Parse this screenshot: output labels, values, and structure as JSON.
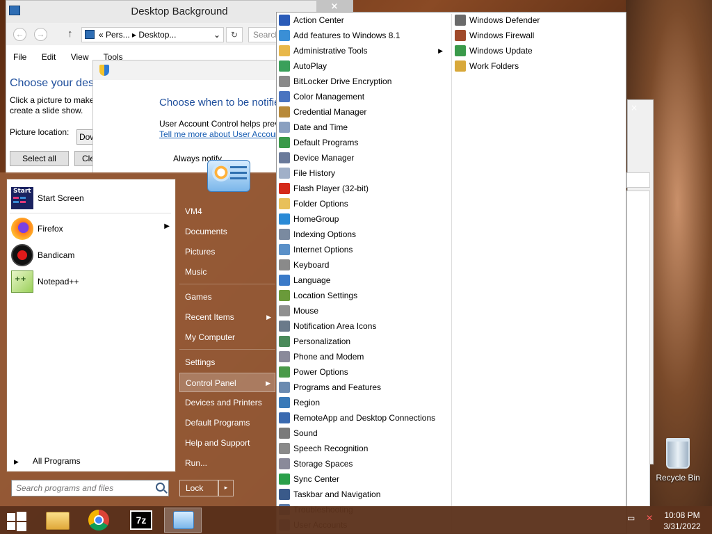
{
  "explorer": {
    "title": "Desktop Background",
    "back": "←",
    "forward": "→",
    "up": "↑",
    "address": "«  Pers...  ▸  Desktop...",
    "address_dropdown": "⌄",
    "refresh": "↻",
    "search_placeholder": "Search",
    "menu": [
      "File",
      "Edit",
      "View",
      "Tools"
    ],
    "heading": "Choose your desktop background",
    "desc1": "Click a picture to make",
    "desc2": "create a slide show.",
    "picture_location_label": "Picture location:",
    "picture_location_value": "Dow",
    "select_all": "Select all",
    "clear_all": "Cle"
  },
  "uac": {
    "heading": "Choose when to be notified",
    "text": "User Account Control helps prevent",
    "link": "Tell me more about User Account",
    "slider_label": "Always notify"
  },
  "start_menu": {
    "pinned": [
      {
        "label": "Start Screen",
        "has_arrow": false
      },
      {
        "label": "Firefox",
        "has_arrow": true
      },
      {
        "label": "Bandicam",
        "has_arrow": false
      },
      {
        "label": "Notepad++",
        "has_arrow": false
      }
    ],
    "start_tile_text": "Start",
    "all_programs": "All Programs",
    "search_placeholder": "Search programs and files",
    "right": [
      {
        "label": "VM4"
      },
      {
        "label": "Documents"
      },
      {
        "label": "Pictures"
      },
      {
        "label": "Music"
      },
      {
        "label": "Games"
      },
      {
        "label": "Recent Items",
        "arrow": true
      },
      {
        "label": "My Computer"
      },
      {
        "label": "Settings"
      },
      {
        "label": "Control Panel",
        "arrow": true,
        "highlighted": true
      },
      {
        "label": "Devices and Printers"
      },
      {
        "label": "Default Programs"
      },
      {
        "label": "Help and Support"
      },
      {
        "label": "Run..."
      }
    ],
    "lock": "Lock",
    "lock_arrow": "▸"
  },
  "control_panel_menu": {
    "close": "×",
    "col1": [
      {
        "label": "Action Center",
        "icon": "flag-icon",
        "color": "#2a5bb8"
      },
      {
        "label": "Add features to Windows 8.1",
        "icon": "windows-icon",
        "color": "#3a8fd6"
      },
      {
        "label": "Administrative Tools",
        "icon": "folder-icon",
        "color": "#e8b84a",
        "arrow": true
      },
      {
        "label": "AutoPlay",
        "icon": "autoplay-icon",
        "color": "#3aa05a"
      },
      {
        "label": "BitLocker Drive Encryption",
        "icon": "drive-lock-icon",
        "color": "#8a8a8a"
      },
      {
        "label": "Color Management",
        "icon": "color-icon",
        "color": "#4a74c0"
      },
      {
        "label": "Credential Manager",
        "icon": "vault-icon",
        "color": "#b88a3a"
      },
      {
        "label": "Date and Time",
        "icon": "clock-icon",
        "color": "#8aa0c0"
      },
      {
        "label": "Default Programs",
        "icon": "default-programs-icon",
        "color": "#3a9a4a"
      },
      {
        "label": "Device Manager",
        "icon": "device-manager-icon",
        "color": "#6a7a9a"
      },
      {
        "label": "File History",
        "icon": "file-history-icon",
        "color": "#a0b0c8"
      },
      {
        "label": "Flash Player (32-bit)",
        "icon": "flash-icon",
        "color": "#d42a1a"
      },
      {
        "label": "Folder Options",
        "icon": "folder-options-icon",
        "color": "#e8c05a"
      },
      {
        "label": "HomeGroup",
        "icon": "homegroup-icon",
        "color": "#2a8ad6"
      },
      {
        "label": "Indexing Options",
        "icon": "indexing-icon",
        "color": "#7a8aa0"
      },
      {
        "label": "Internet Options",
        "icon": "internet-icon",
        "color": "#5a90c8"
      },
      {
        "label": "Keyboard",
        "icon": "keyboard-icon",
        "color": "#8a8a8a"
      },
      {
        "label": "Language",
        "icon": "language-icon",
        "color": "#3a7ac8"
      },
      {
        "label": "Location Settings",
        "icon": "location-icon",
        "color": "#6a9a3a"
      },
      {
        "label": "Mouse",
        "icon": "mouse-icon",
        "color": "#909090"
      },
      {
        "label": "Notification Area Icons",
        "icon": "notification-icon",
        "color": "#6a7a8a"
      },
      {
        "label": "Personalization",
        "icon": "personalization-icon",
        "color": "#4a8a5a"
      },
      {
        "label": "Phone and Modem",
        "icon": "phone-icon",
        "color": "#8a8a9a"
      },
      {
        "label": "Power Options",
        "icon": "power-icon",
        "color": "#4a9a4a"
      },
      {
        "label": "Programs and Features",
        "icon": "programs-icon",
        "color": "#6a8ab0"
      },
      {
        "label": "Region",
        "icon": "region-icon",
        "color": "#3a7ab8"
      },
      {
        "label": "RemoteApp and Desktop Connections",
        "icon": "remoteapp-icon",
        "color": "#3a6ab0"
      },
      {
        "label": "Sound",
        "icon": "sound-icon",
        "color": "#7a7a7a"
      },
      {
        "label": "Speech Recognition",
        "icon": "microphone-icon",
        "color": "#8a8a8a"
      },
      {
        "label": "Storage Spaces",
        "icon": "storage-icon",
        "color": "#8a8a9a"
      },
      {
        "label": "Sync Center",
        "icon": "sync-icon",
        "color": "#2aa04a"
      },
      {
        "label": "Taskbar and Navigation",
        "icon": "taskbar-icon",
        "color": "#3a5a8a"
      },
      {
        "label": "Troubleshooting",
        "icon": "troubleshoot-icon",
        "color": "#5a7aa8"
      },
      {
        "label": "User Accounts",
        "icon": "users-icon",
        "color": "#6a8ab0"
      }
    ],
    "col2": [
      {
        "label": "Windows Defender",
        "icon": "defender-icon",
        "color": "#6a6a6a"
      },
      {
        "label": "Windows Firewall",
        "icon": "firewall-icon",
        "color": "#a04a2a"
      },
      {
        "label": "Windows Update",
        "icon": "update-icon",
        "color": "#3a9a4a"
      },
      {
        "label": "Work Folders",
        "icon": "work-folders-icon",
        "color": "#d8a83a"
      }
    ]
  },
  "desktop": {
    "recycle_bin": "Recycle Bin"
  },
  "taskbar": {
    "time": "10:08 PM",
    "date": "3/31/2022",
    "buttons": [
      "start-button",
      "file-explorer",
      "chrome",
      "7zip",
      "control-panel"
    ]
  },
  "colors": {
    "accent": "#1e4e9c",
    "start_menu": "#96593a",
    "taskbar": "#5c321c"
  }
}
